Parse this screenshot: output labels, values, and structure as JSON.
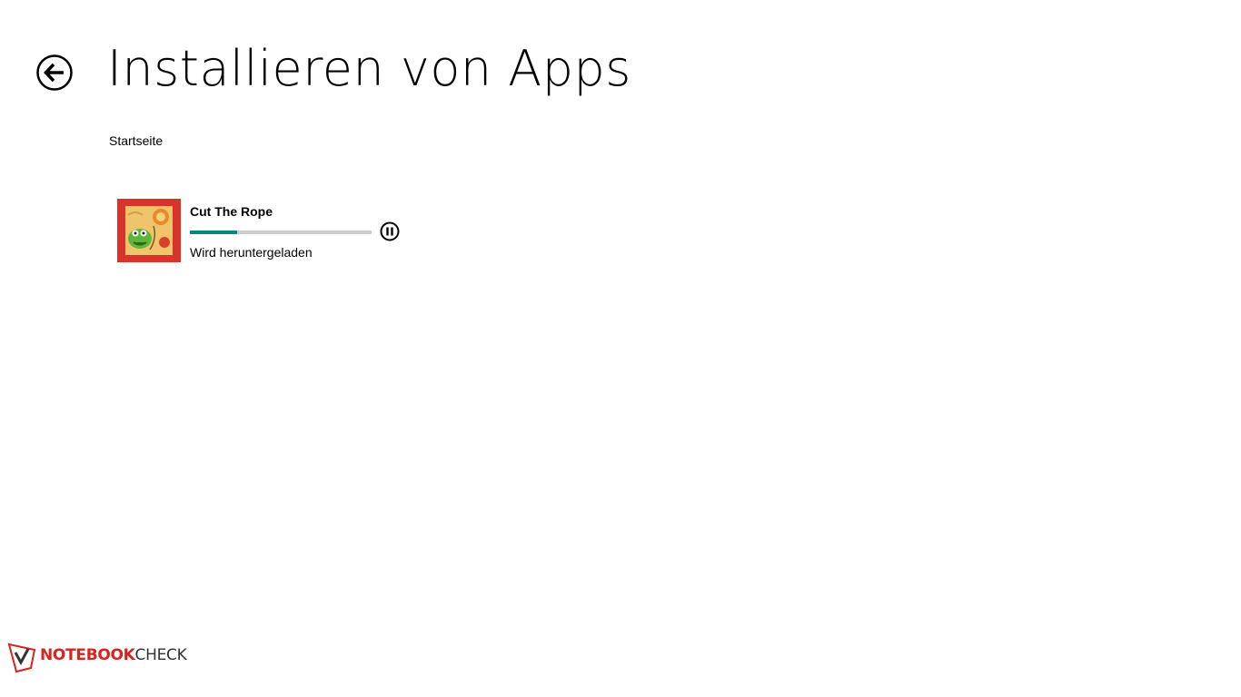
{
  "header": {
    "title": "Installieren von Apps",
    "back_icon": "back-arrow-circle-icon"
  },
  "section": {
    "label": "Startseite"
  },
  "downloads": [
    {
      "name": "Cut The Rope",
      "status": "Wird heruntergeladen",
      "progress_fraction": 0.26,
      "progress_color": "#008a7e",
      "track_color": "#cccccc",
      "tile_color": "#d9342b",
      "action_icon": "pause-circle-icon"
    }
  ],
  "watermark": {
    "brand_part1": "NOTEBOOK",
    "brand_part2": "CHECK",
    "brand_color": "#d8231f"
  }
}
